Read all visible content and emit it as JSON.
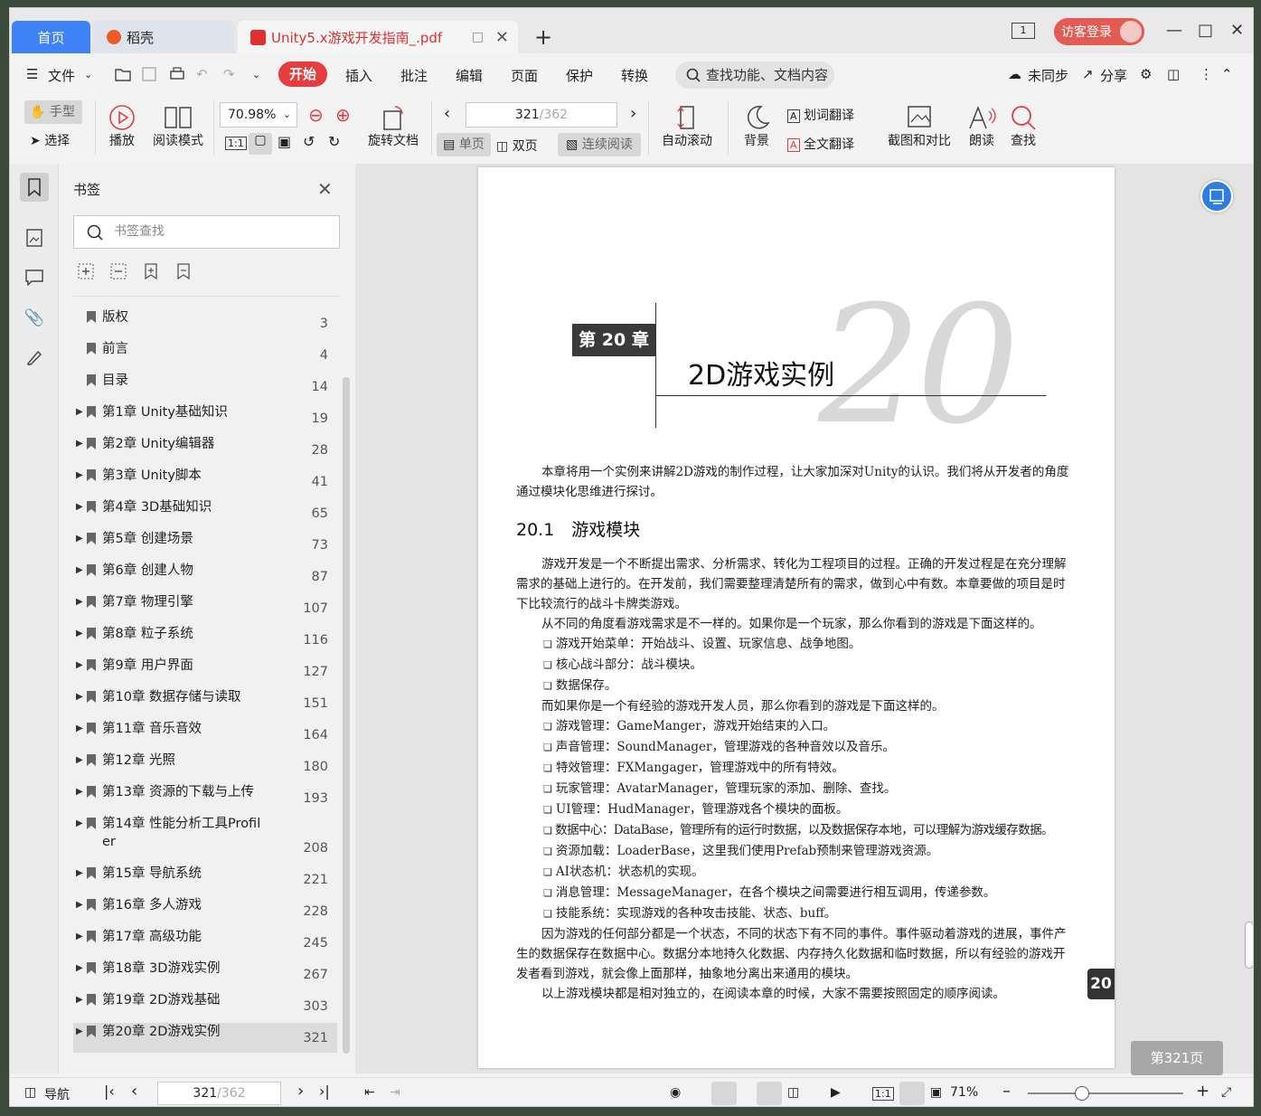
{
  "titlebar": {
    "tabs": [
      {
        "label": "首页"
      },
      {
        "label": "稻壳"
      },
      {
        "label": "Unity5.x游戏开发指南_.pdf"
      }
    ],
    "window_badge": "1",
    "login_label": "访客登录"
  },
  "menu": {
    "file": "文件",
    "items": [
      "开始",
      "插入",
      "批注",
      "编辑",
      "页面",
      "保护",
      "转换"
    ],
    "search_placeholder": "查找功能、文档内容",
    "sync": "未同步",
    "share": "分享"
  },
  "ribbon": {
    "hand": "手型",
    "select": "选择",
    "play": "播放",
    "read_mode": "阅读模式",
    "zoom": "70.98%",
    "rotate": "旋转文档",
    "page_current": "321",
    "page_total": "/362",
    "single": "单页",
    "double": "双页",
    "continuous": "连续阅读",
    "autoscroll": "自动滚动",
    "background": "背景",
    "word_translate": "划词翻译",
    "full_translate": "全文翻译",
    "screenshot": "截图和对比",
    "read_aloud": "朗读",
    "find": "查找"
  },
  "bookmarks": {
    "title": "书签",
    "search_placeholder": "书签查找",
    "items": [
      {
        "label": "版权",
        "page": "3",
        "expandable": false
      },
      {
        "label": "前言",
        "page": "4",
        "expandable": false
      },
      {
        "label": "目录",
        "page": "14",
        "expandable": false
      },
      {
        "label": "第1章 Unity基础知识",
        "page": "19",
        "expandable": true
      },
      {
        "label": "第2章 Unity编辑器",
        "page": "28",
        "expandable": true
      },
      {
        "label": "第3章 Unity脚本",
        "page": "41",
        "expandable": true
      },
      {
        "label": "第4章 3D基础知识",
        "page": "65",
        "expandable": true
      },
      {
        "label": "第5章 创建场景",
        "page": "73",
        "expandable": true
      },
      {
        "label": "第6章 创建人物",
        "page": "87",
        "expandable": true
      },
      {
        "label": "第7章 物理引擎",
        "page": "107",
        "expandable": true
      },
      {
        "label": "第8章 粒子系统",
        "page": "116",
        "expandable": true
      },
      {
        "label": "第9章 用户界面",
        "page": "127",
        "expandable": true
      },
      {
        "label": "第10章 数据存储与读取",
        "page": "151",
        "expandable": true
      },
      {
        "label": "第11章 音乐音效",
        "page": "164",
        "expandable": true
      },
      {
        "label": "第12章 光照",
        "page": "180",
        "expandable": true
      },
      {
        "label": "第13章 资源的下载与上传",
        "page": "193",
        "expandable": true
      },
      {
        "label": "第14章 性能分析工具Profil",
        "label2": "er",
        "page": "208",
        "expandable": true
      },
      {
        "label": "第15章 导航系统",
        "page": "221",
        "expandable": true
      },
      {
        "label": "第16章 多人游戏",
        "page": "228",
        "expandable": true
      },
      {
        "label": "第17章 高级功能",
        "page": "245",
        "expandable": true
      },
      {
        "label": "第18章 3D游戏实例",
        "page": "267",
        "expandable": true
      },
      {
        "label": "第19章 2D游戏基础",
        "page": "303",
        "expandable": true
      },
      {
        "label": "第20章 2D游戏实例",
        "page": "321",
        "expandable": true,
        "selected": true
      }
    ]
  },
  "document": {
    "chapter_badge": "第 20 章",
    "chapter_title": "2D游戏实例",
    "chapter_number": "20",
    "intro": "本章将用一个实例来讲解2D游戏的制作过程，让大家加深对Unity的认识。我们将从开发者的角度通过模块化思维进行探讨。",
    "section_title": "20.1　游戏模块",
    "p1": "游戏开发是一个不断提出需求、分析需求、转化为工程项目的过程。正确的开发过程是在充分理解需求的基础上进行的。在开发前，我们需要整理清楚所有的需求，做到心中有数。本章要做的项目是时下比较流行的战斗卡牌类游戏。",
    "p2": "从不同的角度看游戏需求是不一样的。如果你是一个玩家，那么你看到的游戏是下面这样的。",
    "player_list": [
      "游戏开始菜单：开始战斗、设置、玩家信息、战争地图。",
      "核心战斗部分：战斗模块。",
      "数据保存。"
    ],
    "p3": "而如果你是一个有经验的游戏开发人员，那么你看到的游戏是下面这样的。",
    "dev_list": [
      "游戏管理：GameManger，游戏开始结束的入口。",
      "声音管理：SoundManager，管理游戏的各种音效以及音乐。",
      "特效管理：FXMangager，管理游戏中的所有特效。",
      "玩家管理：AvatarManager，管理玩家的添加、删除、查找。",
      "UI管理：HudManager，管理游戏各个模块的面板。",
      "数据中心：DataBase，管理所有的运行时数据，以及数据保存本地，可以理解为游戏缓存数据。",
      "资源加载：LoaderBase，这里我们使用Prefab预制来管理游戏资源。",
      "AI状态机：状态机的实现。",
      "消息管理：MessageManager，在各个模块之间需要进行相互调用，传递参数。",
      "技能系统：实现游戏的各种攻击技能、状态、buff。"
    ],
    "p4": "因为游戏的任何部分都是一个状态，不同的状态下有不同的事件。事件驱动着游戏的进展，事件产生的数据保存在数据中心。数据分本地持久化数据、内存持久化数据和临时数据，所以有经验的游戏开发者看到游戏，就会像上面那样，抽象地分离出来通用的模块。",
    "p5": "以上游戏模块都是相对独立的，在阅读本章的时候，大家不需要按照固定的顺序阅读。",
    "side_tab": "20",
    "page_indicator": "第321页"
  },
  "statusbar": {
    "nav": "导航",
    "page_current": "321",
    "page_total": "/362",
    "zoom": "71%"
  },
  "colors": {
    "accent_blue": "#3f82f7",
    "accent_red": "#e63e3e"
  }
}
